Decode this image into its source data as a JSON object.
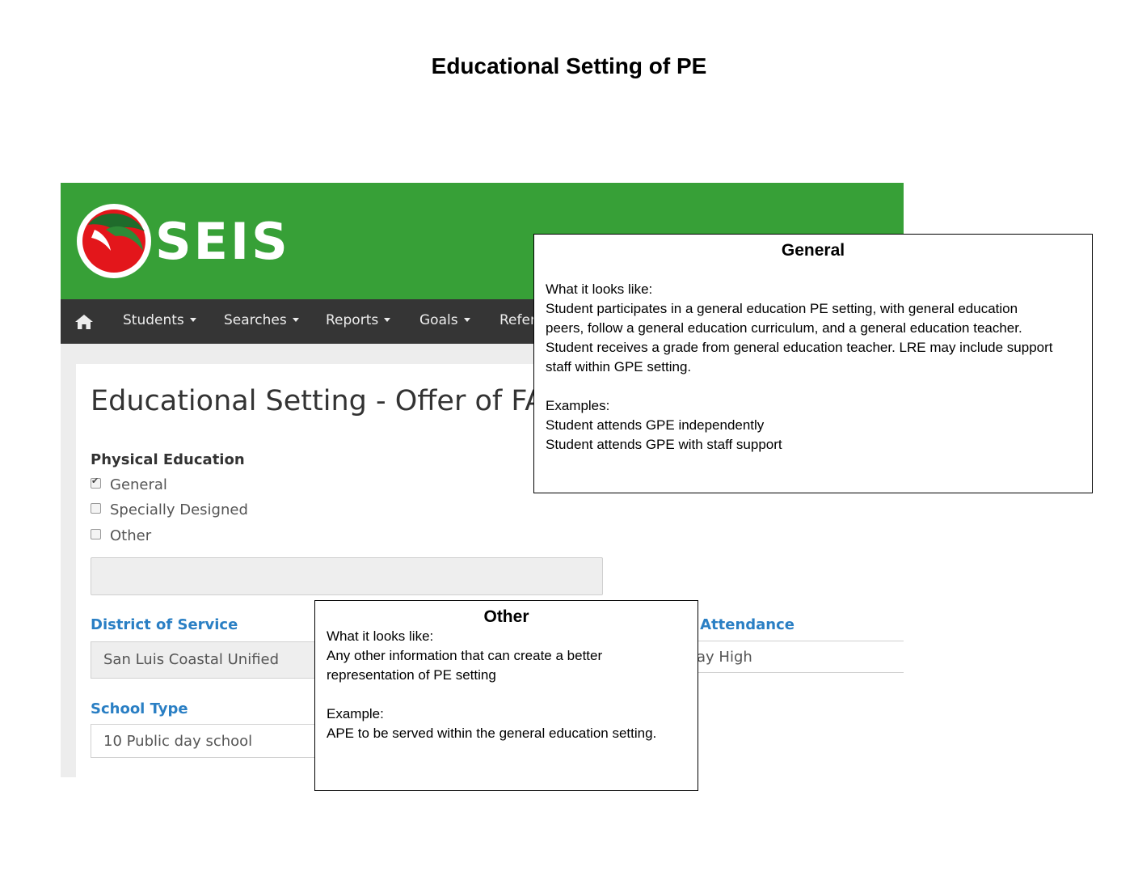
{
  "page_title": "Educational Setting of PE",
  "app": {
    "logo_text": "SEIS",
    "nav": {
      "items": [
        {
          "label": "Students"
        },
        {
          "label": "Searches"
        },
        {
          "label": "Reports"
        },
        {
          "label": "Goals"
        },
        {
          "label": "Refer"
        }
      ]
    },
    "form": {
      "title": "Educational Setting - Offer of FA",
      "pe_label": "Physical Education",
      "options": [
        {
          "label": "General",
          "checked": true
        },
        {
          "label": "Specially Designed",
          "checked": false
        },
        {
          "label": "Other",
          "checked": false
        }
      ],
      "other_value": "",
      "district_label": "District of Service",
      "district_value": "San Luis Coastal Unified",
      "attendance_label": "f Attendance",
      "attendance_value": "ay High",
      "school_type_label": "School Type",
      "school_type_value": "10 Public day school"
    },
    "colors": {
      "header": "#37a037",
      "navbar": "#353535",
      "link_blue": "#2a7fc4",
      "logo_red": "#e3161b"
    }
  },
  "callouts": {
    "general": {
      "title": "General",
      "lines": [
        "What it looks like:",
        "Student participates in a general education PE setting, with general education",
        "peers, follow a general education curriculum, and a general education teacher.",
        "Student receives a grade from general education teacher.  LRE may include support",
        "staff within GPE setting.",
        "",
        "Examples:",
        "Student attends GPE independently",
        "Student attends GPE with staff support"
      ]
    },
    "other": {
      "title": "Other",
      "lines": [
        "What it looks like:",
        "Any other information that can create a better",
        "representation of PE setting",
        "",
        "Example:",
        "APE to be served within the general education setting."
      ]
    }
  }
}
